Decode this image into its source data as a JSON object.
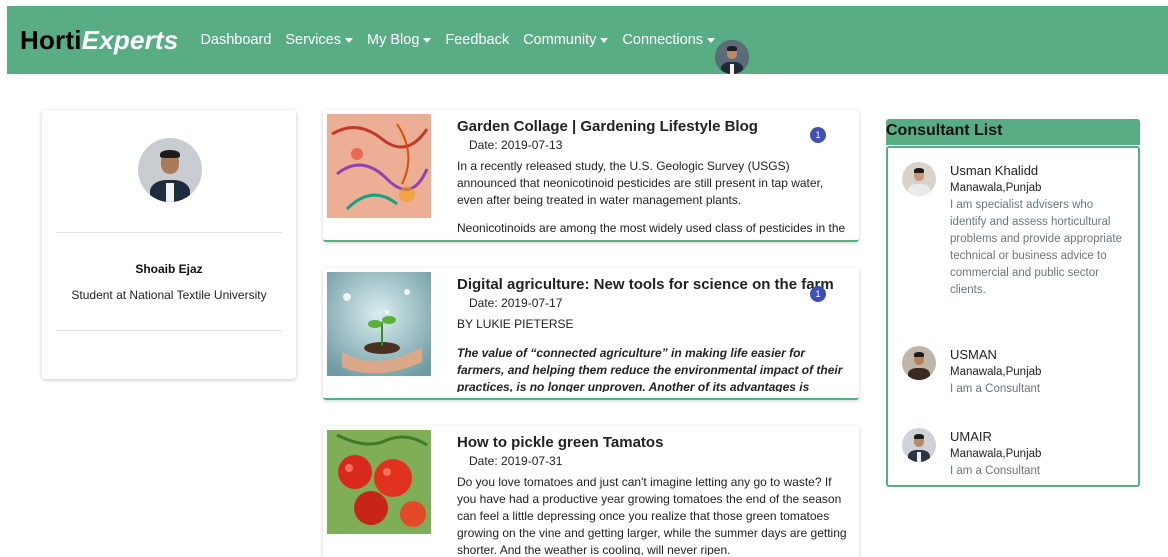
{
  "brand": {
    "part1": "Horti",
    "part2": "Experts"
  },
  "nav": [
    {
      "label": "Dashboard",
      "dropdown": false
    },
    {
      "label": "Services",
      "dropdown": true
    },
    {
      "label": "My Blog",
      "dropdown": true
    },
    {
      "label": "Feedback",
      "dropdown": false
    },
    {
      "label": "Community",
      "dropdown": true
    },
    {
      "label": "Connections",
      "dropdown": true
    }
  ],
  "profile": {
    "name": "Shoaib Ejaz",
    "title": "Student at National Textile University"
  },
  "blogs": [
    {
      "title": "Garden Collage | Gardening Lifestyle Blog",
      "date": "Date: 2019-07-13",
      "badge": "1",
      "paragraphs": [
        "In a recently released study, the U.S. Geologic Survey (USGS) announced that neonicotinoid pesticides are still present in tap water, even after being treated in water management plants.",
        "Neonicotinoids are among the most widely used class of pesticides in the world."
      ]
    },
    {
      "title": "Digital agriculture: New tools for science on the farm",
      "date": "Date: 2019-07-17",
      "badge": "1",
      "byline": "BY LUKIE PIETERSE",
      "emphasis": "The value of “connected agriculture” in making life easier for farmers, and helping them reduce the environmental impact of their practices, is no longer unproven. Another of its advantages is beginning to emerge: by"
    },
    {
      "title": "How to pickle green Tamatos",
      "date": "Date: 2019-07-31",
      "paragraphs": [
        "Do you love tomatoes and just can't imagine letting any go to waste? If you have had a productive year growing tomatoes the end of the season can feel a little depressing once you realize that those green tomatoes growing on the vine and getting larger, while the summer days are getting shorter. And the weather is cooling, will never ripen."
      ]
    }
  ],
  "consultants": {
    "title": "Consultant List",
    "items": [
      {
        "name": "Usman Khalidd",
        "location": "Manawala,Punjab",
        "description": "I am specialist advisers who identify and assess horticultural problems and provide appropriate technical or business advice to commercial and public sector clients."
      },
      {
        "name": "USMAN",
        "location": "Manawala,Punjab",
        "description": "I am a Consultant"
      },
      {
        "name": "UMAIR",
        "location": "Manawala,Punjab",
        "description": "I am a Consultant"
      }
    ]
  },
  "colors": {
    "primary": "#58ad84",
    "badge": "#3f51b5"
  }
}
